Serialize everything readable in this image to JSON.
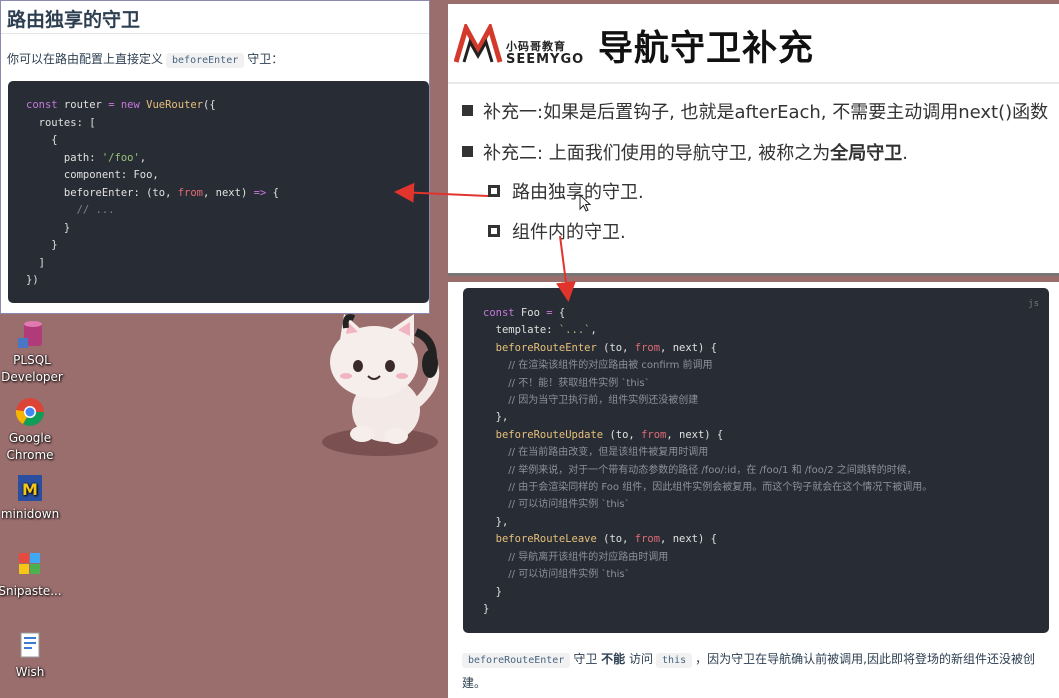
{
  "desktop": {
    "icons": [
      {
        "label_line1": "PLSQL",
        "label_line2": "Developer",
        "icon": "plsql-developer-icon"
      },
      {
        "label_line1": "Google",
        "label_line2": "Chrome",
        "icon": "chrome-icon"
      },
      {
        "label_line1": "minidown",
        "label_line2": "",
        "icon": "minidown-icon"
      },
      {
        "label_line1": "Snipaste...",
        "label_line2": "",
        "icon": "snipaste-icon"
      },
      {
        "label_line1": "Wish",
        "label_line2": "",
        "icon": "wish-icon"
      }
    ]
  },
  "doc_top": {
    "heading": "路由独享的守卫",
    "desc_before": "你可以在路由配置上直接定义",
    "desc_code": "beforeEnter",
    "desc_after": "守卫："
  },
  "slide": {
    "logo_cn": "小码哥教育",
    "logo_en": "SEEMYGO",
    "title": "导航守卫补充",
    "bullet1": "补充一:如果是后置钩子, 也就是afterEach, 不需要主动调用next()函数",
    "bullet2_prefix": "补充二: 上面我们使用的导航守卫, 被称之为",
    "bullet2_bold": "全局守卫",
    "bullet2_suffix": ".",
    "sub1": "路由独享的守卫.",
    "sub2": "组件内的守卫."
  },
  "doc_bottom": {
    "lang_label": "js",
    "note_code1": "beforeRouteEnter",
    "note_text1": "守卫",
    "note_bold": "不能",
    "note_text2": "访问",
    "note_code2": "this",
    "note_text3": "，因为守卫在导航确认前被调用,因此即将登场的新组件还没被创建。"
  },
  "colors": {
    "desktop_bg": "#9b6e6e",
    "code_bg": "#282c34",
    "arrow": "#e0342d"
  }
}
